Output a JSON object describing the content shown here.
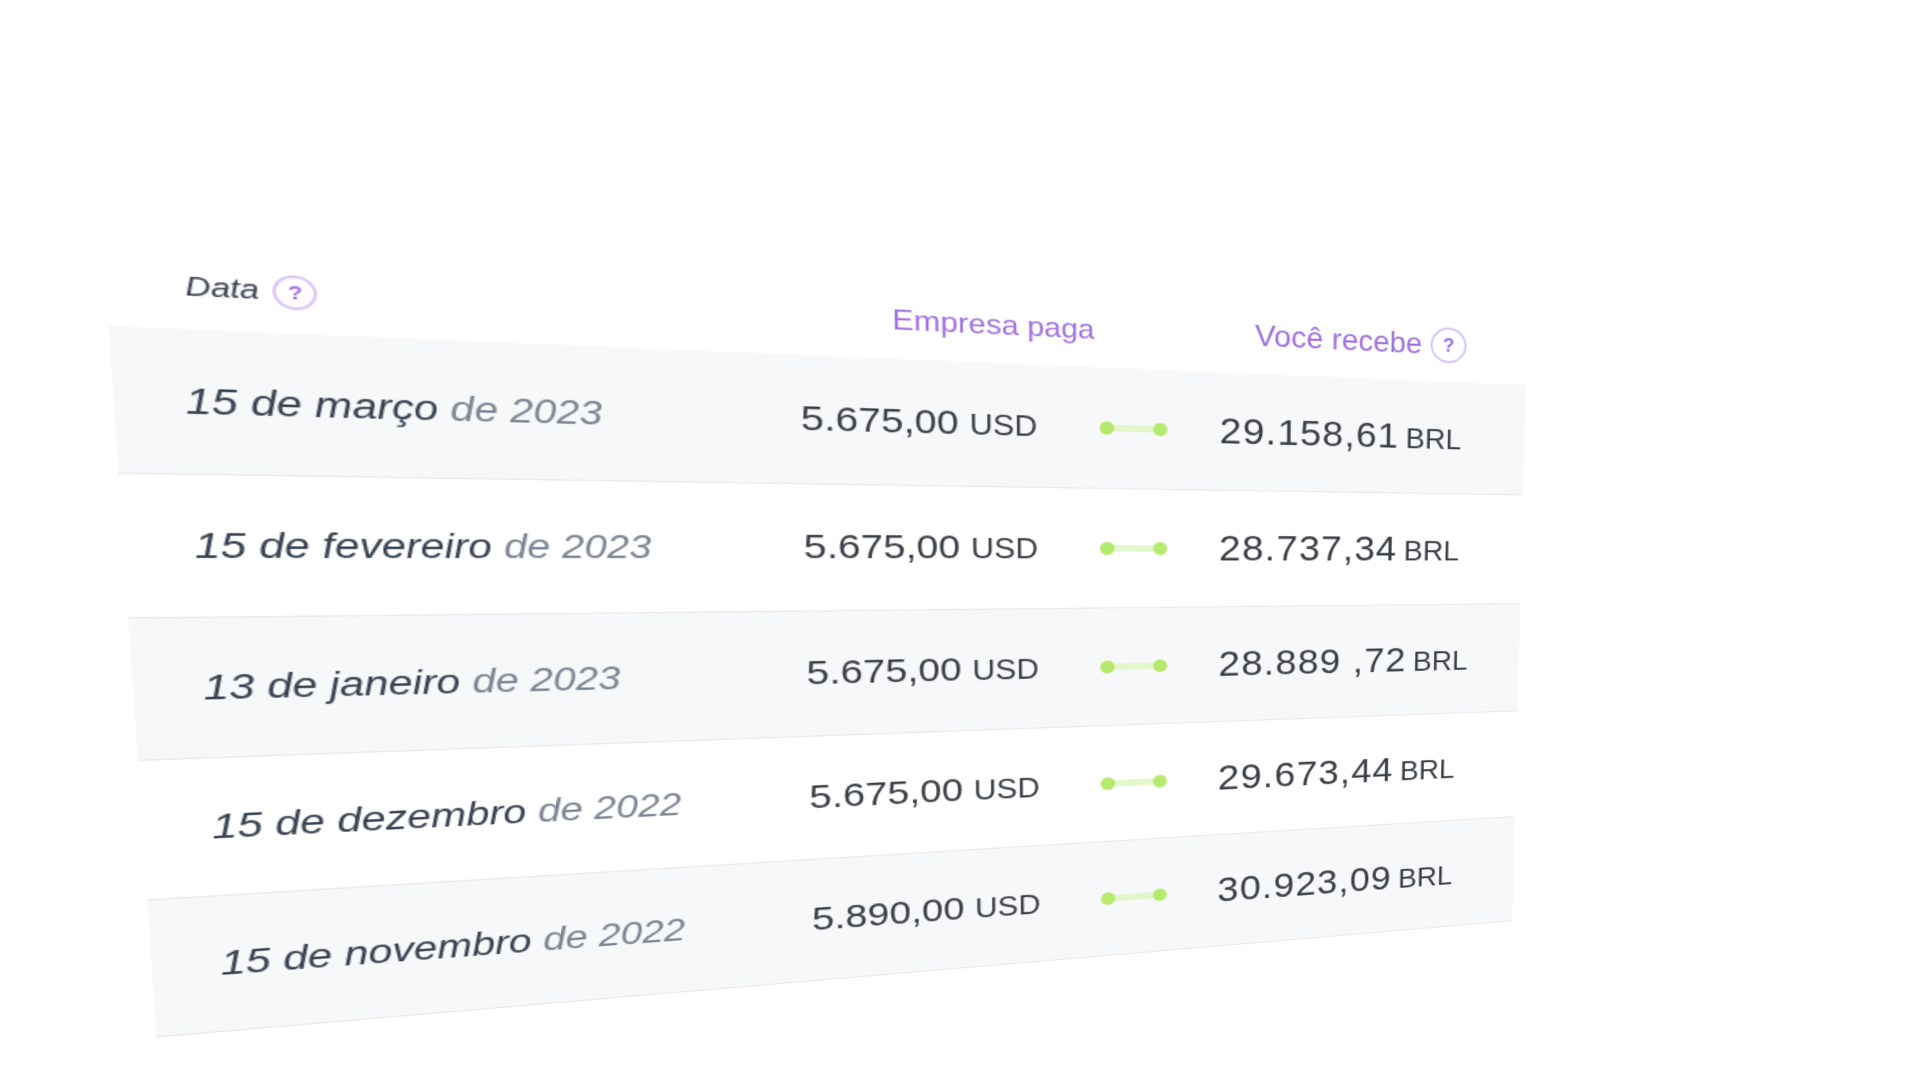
{
  "header": {
    "date_label": "Data",
    "company_pays_label": "Empresa paga",
    "you_receive_label": "Você recebe",
    "help_symbol": "?"
  },
  "rows": [
    {
      "date_main": "15 de março",
      "date_year": "de 2023",
      "paid_amount": "5.675,00",
      "paid_currency": "USD",
      "received_amount": "29.158,61",
      "received_currency": "BRL"
    },
    {
      "date_main": "15 de fevereiro",
      "date_year": "de 2023",
      "paid_amount": "5.675,00",
      "paid_currency": "USD",
      "received_amount": "28.737,34",
      "received_currency": "BRL"
    },
    {
      "date_main": "13 de janeiro",
      "date_year": "de 2023",
      "paid_amount": "5.675,00",
      "paid_currency": "USD",
      "received_amount": "28.889 ,72",
      "received_currency": "BRL"
    },
    {
      "date_main": "15 de dezembro",
      "date_year": "de 2022",
      "paid_amount": "5.675,00",
      "paid_currency": "USD",
      "received_amount": "29.673,44",
      "received_currency": "BRL"
    },
    {
      "date_main": "15 de novembro",
      "date_year": "de 2022",
      "paid_amount": "5.890,00",
      "paid_currency": "USD",
      "received_amount": "30.923,09",
      "received_currency": "BRL"
    }
  ],
  "colors": {
    "accent": "#a070e0",
    "connector": "#b6ea6f",
    "row_shade": "#f7f8fa"
  }
}
